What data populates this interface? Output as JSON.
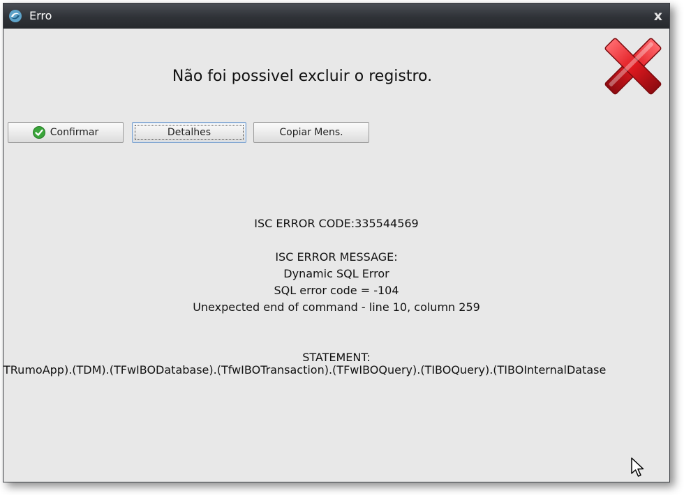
{
  "window": {
    "title": "Erro",
    "close_glyph": "x",
    "icon": "app-swirl-icon"
  },
  "headline": "Não foi possivel excluir o registro.",
  "buttons": {
    "confirm": "Confirmar",
    "details": "Detalhes",
    "copy": "Copiar Mens."
  },
  "details": {
    "error_code": "ISC ERROR CODE:335544569",
    "message_label": "ISC ERROR MESSAGE:",
    "message_lines": [
      "Dynamic SQL Error",
      "SQL error code = -104",
      "Unexpected end of command - line 10, column 259"
    ],
    "statement_label": "STATEMENT:",
    "statement_text": "TRumoApp).(TDM).(TFwIBODatabase).(TfwIBOTransaction).(TFwIBOQuery).(TIBOQuery).(TIBOInternalDatase"
  },
  "colors": {
    "error_red": "#e0191f",
    "titlebar": "#2f3237",
    "background": "#e8e8e8",
    "check_green": "#3aa53a"
  }
}
